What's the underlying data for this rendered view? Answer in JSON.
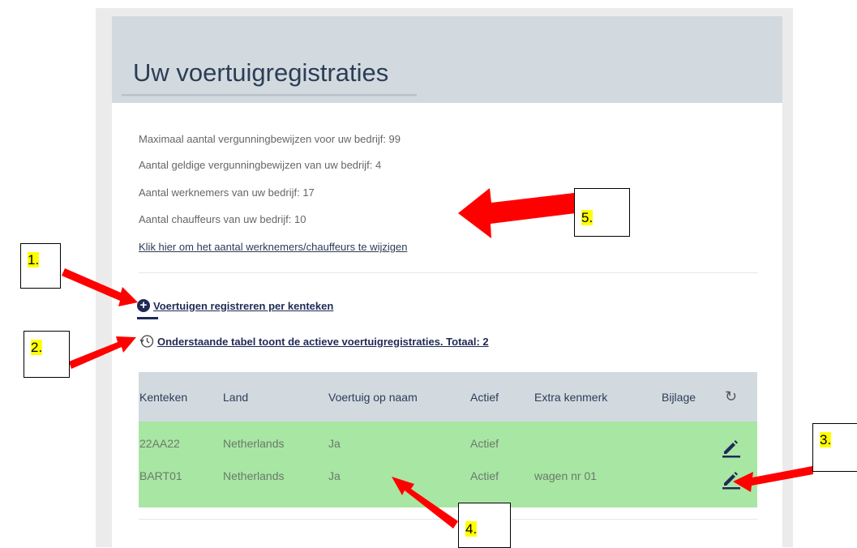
{
  "header": {
    "title": "Uw voertuigregistraties"
  },
  "info": {
    "lines": [
      "Maximaal aantal vergunningbewijzen voor uw bedrijf: 99",
      "Aantal geldige vergunningbewijzen van uw bedrijf: 4",
      "Aantal werknemers van uw bedrijf: 17",
      "Aantal chauffeurs van uw bedrijf: 10"
    ],
    "link": "Klik hier om het aantal werknemers/chauffeurs te wijzigen"
  },
  "actions": {
    "register": "Voertuigen registreren per kenteken",
    "history": "Onderstaande tabel toont de actieve voertuigregistraties. Totaal: 2"
  },
  "table": {
    "headers": [
      "Kenteken",
      "Land",
      "Voertuig op naam",
      "Actief",
      "Extra kenmerk",
      "Bijlage"
    ],
    "rows": [
      [
        "22AA22",
        "Netherlands",
        "Ja",
        "Actief",
        "",
        ""
      ],
      [
        "BART01",
        "Netherlands",
        "Ja",
        "Actief",
        "wagen nr 01",
        ""
      ]
    ]
  },
  "annotations": [
    "1.",
    "2.",
    "3.",
    "4.",
    "5."
  ],
  "colors": {
    "header_bg": "#d2dae0",
    "row_bg": "#a8e6a3",
    "title": "#2c3d55",
    "arrow": "#ff0000",
    "highlight": "#ffff00"
  }
}
